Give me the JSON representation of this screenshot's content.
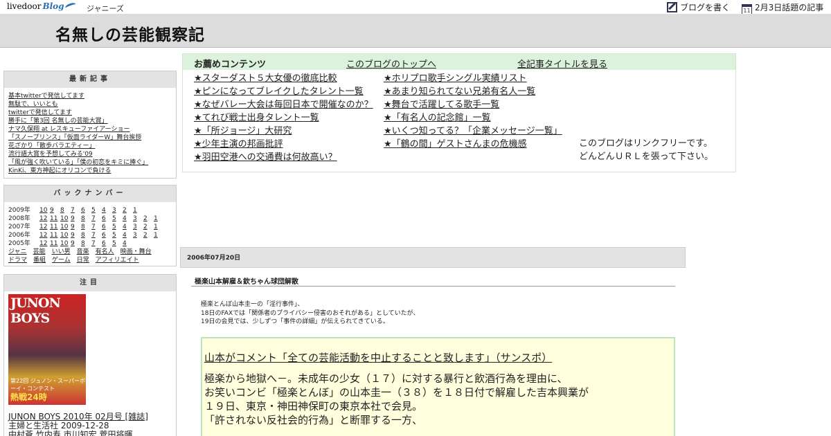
{
  "topbar": {
    "logo_main": "livedoor",
    "logo_blog": "Blog",
    "genre": "ジャニーズ",
    "write_blog": "ブログを書く",
    "calendar_day": "11",
    "topic": "2月3日話題の記事"
  },
  "header": {
    "title": "名無しの芸能観察記"
  },
  "recent": {
    "title": "最新記事",
    "items": [
      "基本twitterで発信してます",
      "無駄で、いいとも",
      "twitterで発信してます",
      "勝手に「第3回 名無しの芸能大賞」",
      "ナマ久保翔 at レスキューファイアーショー",
      "「スノープリンス」「仮面ライダーW」舞台挨拶",
      "花ざかり「散歩バラエティー」",
      "流行語大賞を予想してみる'09",
      "「風が強く吹いている」「僕の初恋をキミに捧ぐ」",
      "KinKi、東方神起にオリコンで負ける"
    ]
  },
  "backnumber": {
    "title": "バックナンバー",
    "rows": [
      {
        "year": "2009年",
        "months": [
          "10",
          "9",
          "8",
          "7",
          "6",
          "5",
          "4",
          "3",
          "2",
          "1"
        ]
      },
      {
        "year": "2008年",
        "months": [
          "12",
          "11",
          "10",
          "9",
          "8",
          "7",
          "6",
          "5",
          "4",
          "3",
          "2",
          "1"
        ]
      },
      {
        "year": "2007年",
        "months": [
          "12",
          "11",
          "10",
          "9",
          "8",
          "7",
          "6",
          "5",
          "4",
          "3",
          "2",
          "1"
        ]
      },
      {
        "year": "2006年",
        "months": [
          "12",
          "11",
          "10",
          "9",
          "8",
          "7",
          "6",
          "5",
          "4",
          "3",
          "2",
          "1"
        ]
      },
      {
        "year": "2005年",
        "months": [
          "12",
          "11",
          "10",
          "9",
          "8",
          "7",
          "6",
          "5",
          "4"
        ]
      }
    ],
    "categories_1": [
      "ジャニ",
      "芸能",
      "いい男",
      "音楽",
      "有名人",
      "映画・舞台"
    ],
    "categories_2": [
      "ドラマ",
      "番組",
      "ゲーム",
      "日常",
      "アフィリエイト"
    ]
  },
  "attention": {
    "title": "注目",
    "cover_title": "JUNON BOYS",
    "cover_sub": "第22回 ジュノン・スーパーボーイ・コンテスト",
    "cover_main": "熱戦24時",
    "product": "JUNON BOYS 2010年 02月号 [雑誌]",
    "publisher": "主婦と生活社 2009-12-28",
    "cast": "中村蒼 竹内寿 市川知宏 菅田将暉"
  },
  "recommend": {
    "heading": "お薦めコンテンツ",
    "top_link": "このブログのトップへ",
    "all_titles_link": "全記事タイトルを見る",
    "col1": [
      "★スターダスト５大女優の徹底比較",
      "★ピンになってブレイクしたタレント一覧",
      "★なぜバレー大会は毎回日本で開催なのか？",
      "★てれび戦士出身タレント一覧",
      "★「所ジョージ」大研究",
      "★少年主演の邦画批評",
      "★羽田空港への交通費は何故高い？"
    ],
    "col2": [
      "★ホリプロ歌手シングル実績リスト",
      "★あまり知られてない兄弟有名人一覧",
      "★舞台で活躍してる歌手一覧",
      "★「有名人の記念館」一覧",
      "★いくつ知ってる？「企業メッセージ一覧」",
      "★「鶴の間」ゲストさんまの危機感"
    ],
    "free_1": "このブログはリンクフリーです。",
    "free_2": "どんどんＵＲＬを張って下さい。"
  },
  "post": {
    "date": "2006年07月20日",
    "title": "極楽山本解雇＆欽ちゃん球団解散",
    "intro": [
      "極楽とんぼ山本圭一の「淫行事件」、",
      "18日のFAXでは「関係者のプライバシー侵害のおそれがある」としていたが、",
      "19日の会見では、少しずつ「事件の詳細」が伝えられてきている。"
    ],
    "quote_link": "山本がコメント「全ての芸能活動を中止することと致します」（サンスポ）",
    "quote_lines": [
      "極楽から地獄へ－。未成年の少女（１７）に対する暴行と飲酒行為を理由に、",
      "お笑いコンビ「極楽とんぼ」の山本圭一（３８）を１８日付で解雇した吉本興業が",
      "１９日、東京・神田神保町の東京本社で会見。",
      "「許されない反社会的行為」と断罪する一方、"
    ]
  }
}
